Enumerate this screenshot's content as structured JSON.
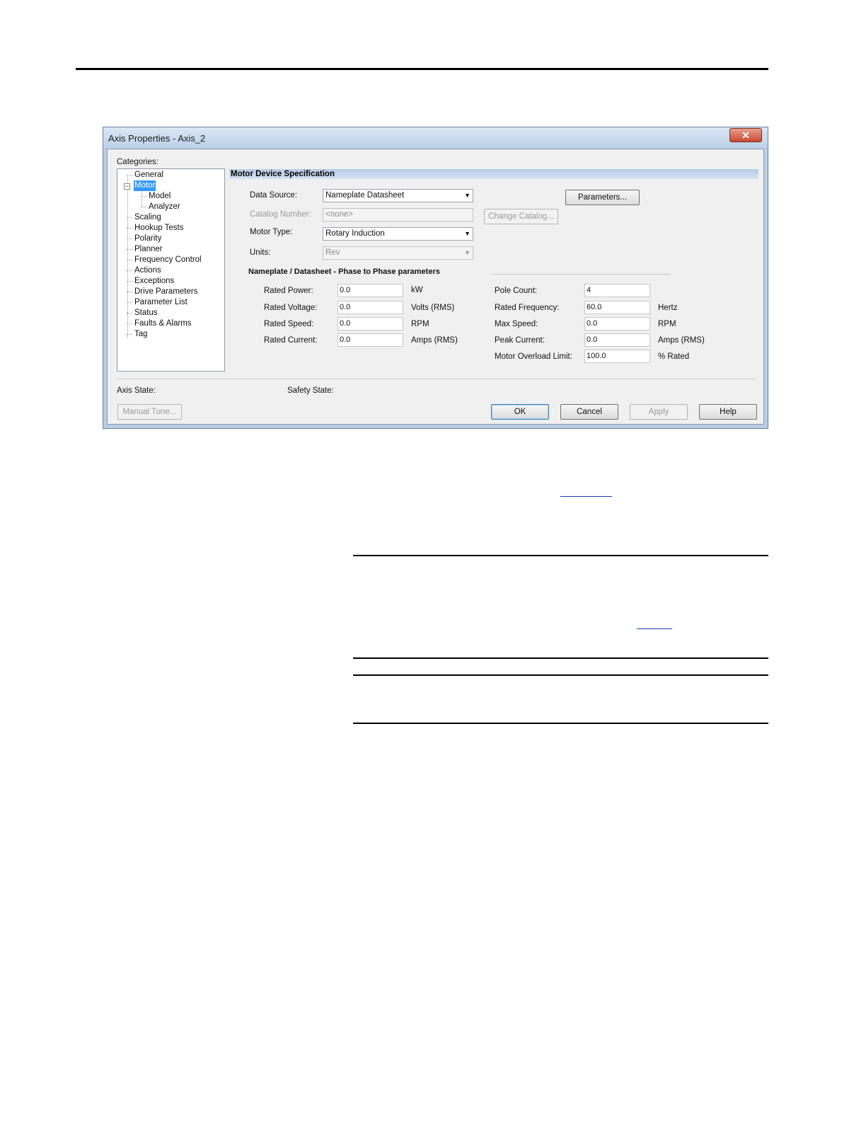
{
  "dialog": {
    "title": "Axis Properties - Axis_2",
    "categories_label": "Categories:",
    "tree": [
      "General",
      "Motor",
      "Model",
      "Analyzer",
      "Scaling",
      "Hookup Tests",
      "Polarity",
      "Planner",
      "Frequency Control",
      "Actions",
      "Exceptions",
      "Drive Parameters",
      "Parameter List",
      "Status",
      "Faults & Alarms",
      "Tag"
    ],
    "selected_category": "Motor",
    "section_header": "Motor Device Specification",
    "data_source": {
      "label": "Data Source:",
      "value": "Nameplate Datasheet"
    },
    "catalog_number": {
      "label": "Catalog Number:",
      "value": "<none>"
    },
    "motor_type": {
      "label": "Motor Type:",
      "value": "Rotary Induction"
    },
    "units": {
      "label": "Units:",
      "value": "Rev"
    },
    "parameters_button": "Parameters...",
    "change_catalog_button": "Change Catalog...",
    "nameplate_heading": "Nameplate / Datasheet - Phase to Phase parameters",
    "left_params": [
      {
        "label": "Rated Power:",
        "value": "0.0",
        "unit": "kW"
      },
      {
        "label": "Rated Voltage:",
        "value": "0.0",
        "unit": "Volts (RMS)"
      },
      {
        "label": "Rated Speed:",
        "value": "0.0",
        "unit": "RPM"
      },
      {
        "label": "Rated Current:",
        "value": "0.0",
        "unit": "Amps (RMS)"
      }
    ],
    "right_params": [
      {
        "label": "Pole Count:",
        "value": "4",
        "unit": ""
      },
      {
        "label": "Rated Frequency:",
        "value": "60.0",
        "unit": "Hertz"
      },
      {
        "label": "Max Speed:",
        "value": "0.0",
        "unit": "RPM"
      },
      {
        "label": "Peak Current:",
        "value": "0.0",
        "unit": "Amps (RMS)"
      },
      {
        "label": "Motor Overload Limit:",
        "value": "100.0",
        "unit": "% Rated"
      }
    ],
    "axis_state_label": "Axis State:",
    "safety_state_label": "Safety State:",
    "manual_tune_button": "Manual Tune...",
    "ok_button": "OK",
    "cancel_button": "Cancel",
    "apply_button": "Apply",
    "help_button": "Help"
  }
}
